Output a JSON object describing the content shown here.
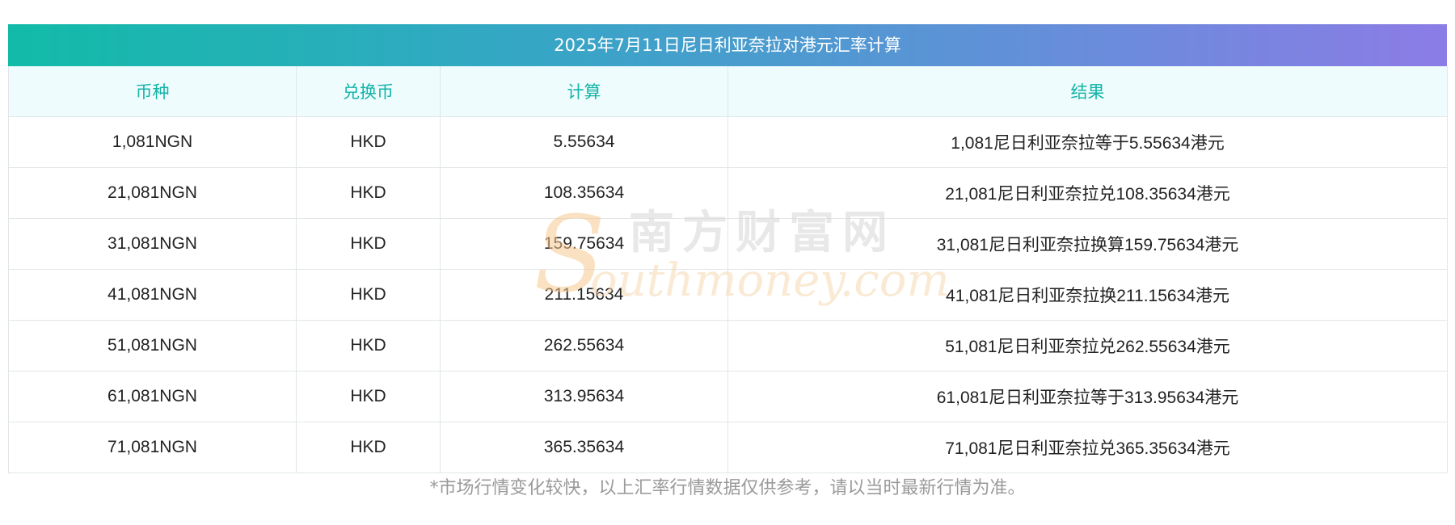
{
  "title": "2025年7月11日尼日利亚奈拉对港元汇率计算",
  "columns": [
    "币种",
    "兑换币",
    "计算",
    "结果"
  ],
  "rows": [
    [
      "1,081NGN",
      "HKD",
      "5.55634",
      "1,081尼日利亚奈拉等于5.55634港元"
    ],
    [
      "21,081NGN",
      "HKD",
      "108.35634",
      "21,081尼日利亚奈拉兑108.35634港元"
    ],
    [
      "31,081NGN",
      "HKD",
      "159.75634",
      "31,081尼日利亚奈拉换算159.75634港元"
    ],
    [
      "41,081NGN",
      "HKD",
      "211.15634",
      "41,081尼日利亚奈拉换211.15634港元"
    ],
    [
      "51,081NGN",
      "HKD",
      "262.55634",
      "51,081尼日利亚奈拉兑262.55634港元"
    ],
    [
      "61,081NGN",
      "HKD",
      "313.95634",
      "61,081尼日利亚奈拉等于313.95634港元"
    ],
    [
      "71,081NGN",
      "HKD",
      "365.35634",
      "71,081尼日利亚奈拉兑365.35634港元"
    ]
  ],
  "note": "*市场行情变化较快，以上汇率行情数据仅供参考，请以当时最新行情为准。",
  "watermark": {
    "s": "S",
    "cn": "南方财富网",
    "en": "outhmoney.com"
  },
  "colors": {
    "header_text": "#14b3a8",
    "gradient_start": "#12bba8",
    "gradient_end": "#8c7ce6"
  }
}
